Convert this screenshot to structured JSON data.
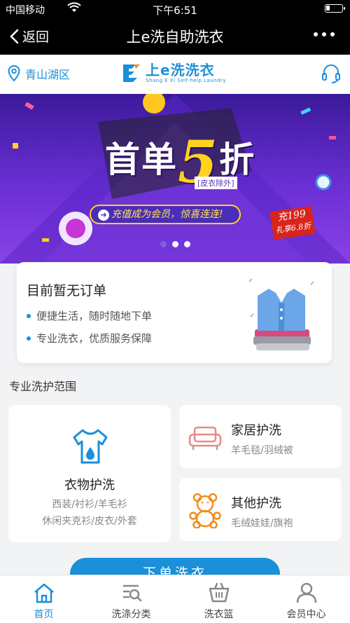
{
  "status_bar": {
    "carrier": "中国移动",
    "time": "下午6:51",
    "wifi_icon": "wifi-icon",
    "battery_icon": "battery-icon"
  },
  "nav": {
    "back_label": "返回",
    "title": "上e洗自助洗衣",
    "more_icon": "more-icon"
  },
  "header": {
    "location": "青山湖区",
    "logo_text": "上e洗洗衣",
    "logo_subtitle": "Shang E Xi Self-help Laundry",
    "support_icon": "headset-icon"
  },
  "banner": {
    "headline_prefix": "首单",
    "headline_number": "5",
    "headline_suffix": "折",
    "note": "[皮衣除外]",
    "promo": "充值成为会员，惊喜连连!",
    "tag_line1": "充199",
    "tag_line2": "礼享6.8折",
    "slide_count": 3,
    "active_slide": 1
  },
  "order_card": {
    "title": "目前暂无订单",
    "bullets": [
      "便捷生活，随时随地下单",
      "专业洗衣，优质服务保障"
    ]
  },
  "services": {
    "section_title": "专业洗护范围",
    "clothing": {
      "name": "衣物护洗",
      "desc1": "西装/衬衫/羊毛衫",
      "desc2": "休闲夹克衫/皮衣/外套",
      "icon": "tshirt-icon"
    },
    "home": {
      "name": "家居护洗",
      "desc": "羊毛毯/羽绒被",
      "icon": "sofa-icon"
    },
    "other": {
      "name": "其他护洗",
      "desc": "毛绒娃娃/旗袍",
      "icon": "teddy-bear-icon"
    }
  },
  "order_button": {
    "label": "下单洗衣"
  },
  "tabbar": {
    "tabs": [
      {
        "label": "首页",
        "icon": "home-icon",
        "active": true
      },
      {
        "label": "洗涤分类",
        "icon": "category-icon",
        "active": false
      },
      {
        "label": "洗衣篮",
        "icon": "basket-icon",
        "active": false
      },
      {
        "label": "会员中心",
        "icon": "user-icon",
        "active": false
      }
    ]
  },
  "colors": {
    "brand": "#1b8fd8",
    "banner_top": "#3b1a9a",
    "banner_bottom": "#8a42e6",
    "accent_yellow": "#ffd21e",
    "tag_red": "#d9241c"
  }
}
